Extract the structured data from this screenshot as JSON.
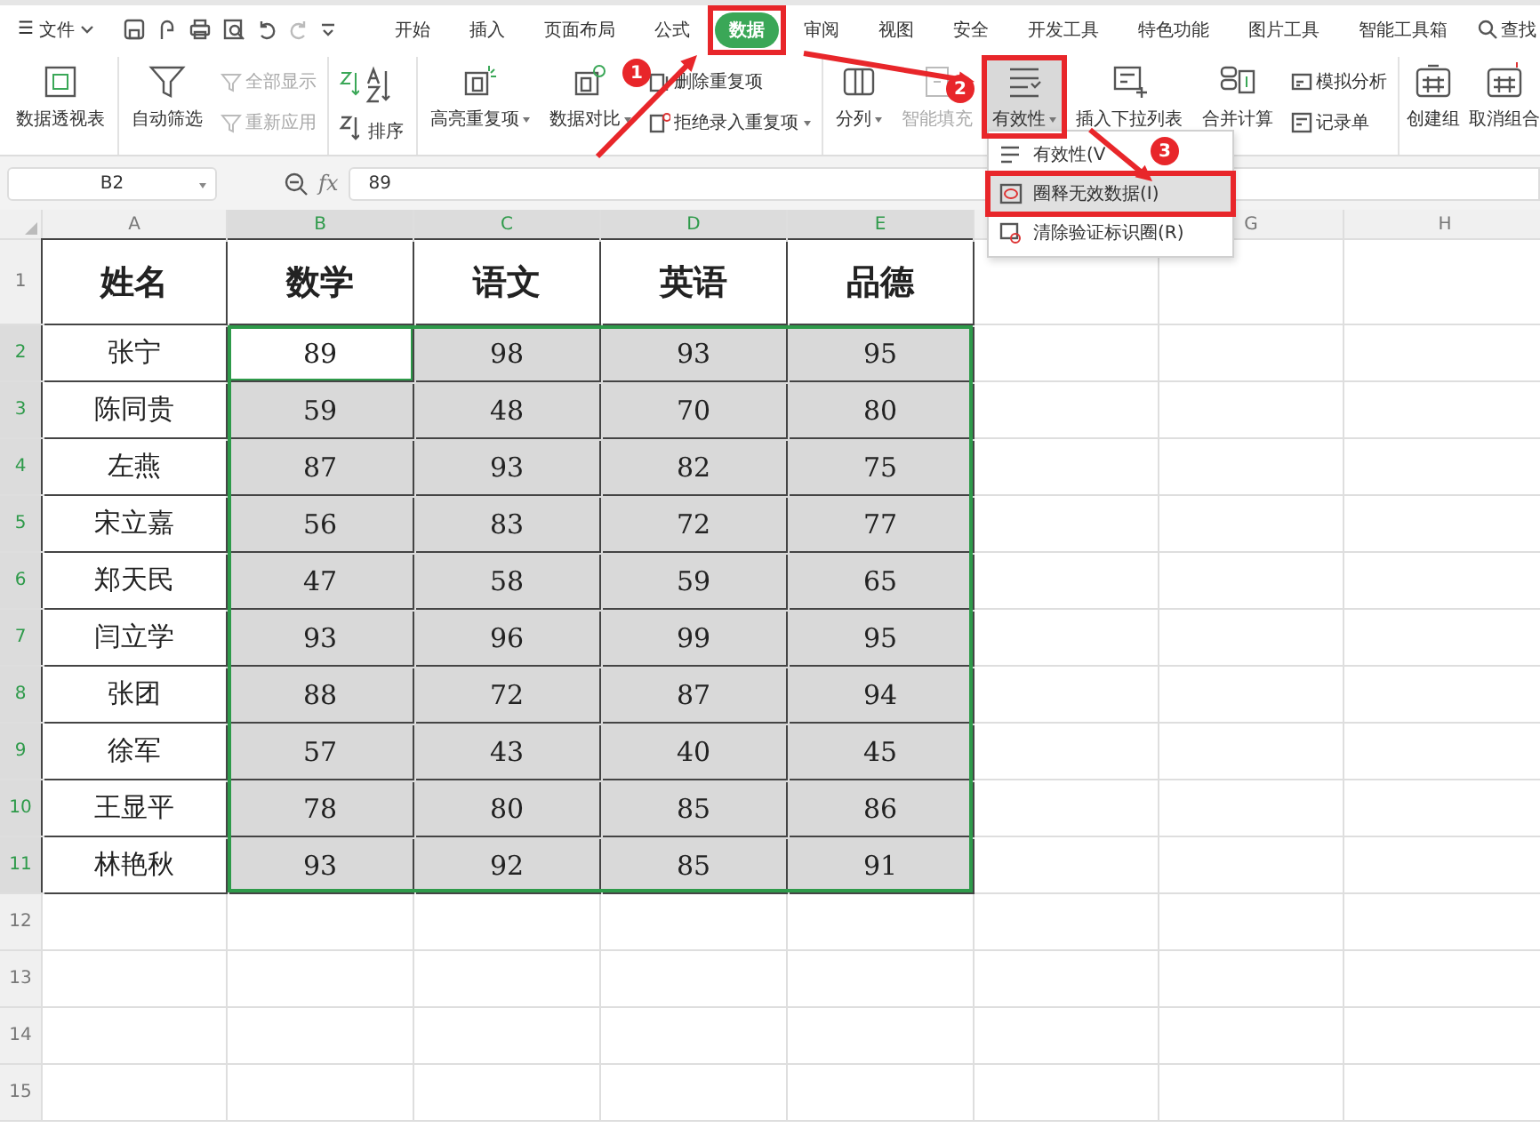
{
  "menubar": {
    "menu_icon": "☰",
    "file_label": "文件",
    "tabs": [
      {
        "label": "开始",
        "selected": false
      },
      {
        "label": "插入",
        "selected": false
      },
      {
        "label": "页面布局",
        "selected": false
      },
      {
        "label": "公式",
        "selected": false
      },
      {
        "label": "数据",
        "selected": true
      },
      {
        "label": "审阅",
        "selected": false
      },
      {
        "label": "视图",
        "selected": false
      },
      {
        "label": "安全",
        "selected": false
      },
      {
        "label": "开发工具",
        "selected": false
      },
      {
        "label": "特色功能",
        "selected": false
      },
      {
        "label": "图片工具",
        "selected": false
      },
      {
        "label": "智能工具箱",
        "selected": false
      }
    ],
    "search_label": "查找"
  },
  "ribbon": {
    "groups": [
      {
        "items": [
          {
            "kind": "large",
            "label": "数据透视表",
            "dropdown": false,
            "disabled": false,
            "pressed": false
          }
        ]
      },
      {
        "items": [
          {
            "kind": "large",
            "label": "自动筛选",
            "dropdown": false,
            "disabled": false,
            "pressed": false
          },
          {
            "kind": "stack",
            "items": [
              {
                "label": "全部显示",
                "dropdown": false,
                "disabled": true
              },
              {
                "label": "重新应用",
                "dropdown": false,
                "disabled": true
              }
            ]
          }
        ]
      },
      {
        "items": [
          {
            "kind": "sort",
            "label": "排序"
          }
        ]
      },
      {
        "items": [
          {
            "kind": "large",
            "label": "高亮重复项",
            "dropdown": true,
            "disabled": false,
            "pressed": false
          },
          {
            "kind": "large",
            "label": "数据对比",
            "dropdown": true,
            "disabled": false,
            "pressed": false
          },
          {
            "kind": "stack",
            "items": [
              {
                "label": "删除重复项",
                "dropdown": false,
                "disabled": false
              },
              {
                "label": "拒绝录入重复项",
                "dropdown": true,
                "disabled": false
              }
            ]
          }
        ]
      },
      {
        "items": [
          {
            "kind": "large",
            "label": "分列",
            "dropdown": true,
            "disabled": false,
            "pressed": false
          },
          {
            "kind": "large",
            "label": "智能填充",
            "dropdown": false,
            "disabled": true,
            "pressed": false
          },
          {
            "kind": "large",
            "label": "有效性",
            "dropdown": true,
            "disabled": false,
            "pressed": true
          },
          {
            "kind": "large",
            "label": "插入下拉列表",
            "dropdown": false,
            "disabled": false,
            "pressed": false
          },
          {
            "kind": "large",
            "label": "合并计算",
            "dropdown": false,
            "disabled": false,
            "pressed": false
          },
          {
            "kind": "stack",
            "items": [
              {
                "label": "模拟分析",
                "dropdown": false,
                "disabled": false
              },
              {
                "label": "记录单",
                "dropdown": false,
                "disabled": false
              }
            ]
          }
        ]
      },
      {
        "items": [
          {
            "kind": "large",
            "label": "创建组",
            "dropdown": false,
            "disabled": false,
            "pressed": false
          },
          {
            "kind": "large",
            "label": "取消组合",
            "dropdown": false,
            "disabled": false,
            "pressed": false
          }
        ]
      }
    ]
  },
  "formula_bar": {
    "cell_ref": "B2",
    "fx": "fx",
    "value": "89"
  },
  "sheet": {
    "columns": [
      "A",
      "B",
      "C",
      "D",
      "E",
      null,
      "G",
      "H"
    ],
    "header_row": {
      "number": "1",
      "cells": [
        "姓名",
        "数学",
        "语文",
        "英语",
        "品德"
      ]
    },
    "rows": [
      {
        "number": "2",
        "cells": [
          {
            "text": "张宁",
            "selected": false,
            "active": false
          },
          {
            "text": "89",
            "selected": true,
            "active": true
          },
          {
            "text": "98",
            "selected": true,
            "active": false
          },
          {
            "text": "93",
            "selected": true,
            "active": false
          },
          {
            "text": "95",
            "selected": true,
            "active": false
          }
        ]
      },
      {
        "number": "3",
        "cells": [
          {
            "text": "陈同贵",
            "selected": false,
            "active": false
          },
          {
            "text": "59",
            "selected": true,
            "active": false
          },
          {
            "text": "48",
            "selected": true,
            "active": false
          },
          {
            "text": "70",
            "selected": true,
            "active": false
          },
          {
            "text": "80",
            "selected": true,
            "active": false
          }
        ]
      },
      {
        "number": "4",
        "cells": [
          {
            "text": "左燕",
            "selected": false,
            "active": false
          },
          {
            "text": "87",
            "selected": true,
            "active": false
          },
          {
            "text": "93",
            "selected": true,
            "active": false
          },
          {
            "text": "82",
            "selected": true,
            "active": false
          },
          {
            "text": "75",
            "selected": true,
            "active": false
          }
        ]
      },
      {
        "number": "5",
        "cells": [
          {
            "text": "宋立嘉",
            "selected": false,
            "active": false
          },
          {
            "text": "56",
            "selected": true,
            "active": false
          },
          {
            "text": "83",
            "selected": true,
            "active": false
          },
          {
            "text": "72",
            "selected": true,
            "active": false
          },
          {
            "text": "77",
            "selected": true,
            "active": false
          }
        ]
      },
      {
        "number": "6",
        "cells": [
          {
            "text": "郑天民",
            "selected": false,
            "active": false
          },
          {
            "text": "47",
            "selected": true,
            "active": false
          },
          {
            "text": "58",
            "selected": true,
            "active": false
          },
          {
            "text": "59",
            "selected": true,
            "active": false
          },
          {
            "text": "65",
            "selected": true,
            "active": false
          }
        ]
      },
      {
        "number": "7",
        "cells": [
          {
            "text": "闫立学",
            "selected": false,
            "active": false
          },
          {
            "text": "93",
            "selected": true,
            "active": false
          },
          {
            "text": "96",
            "selected": true,
            "active": false
          },
          {
            "text": "99",
            "selected": true,
            "active": false
          },
          {
            "text": "95",
            "selected": true,
            "active": false
          }
        ]
      },
      {
        "number": "8",
        "cells": [
          {
            "text": "张团",
            "selected": false,
            "active": false
          },
          {
            "text": "88",
            "selected": true,
            "active": false
          },
          {
            "text": "72",
            "selected": true,
            "active": false
          },
          {
            "text": "87",
            "selected": true,
            "active": false
          },
          {
            "text": "94",
            "selected": true,
            "active": false
          }
        ]
      },
      {
        "number": "9",
        "cells": [
          {
            "text": "徐军",
            "selected": false,
            "active": false
          },
          {
            "text": "57",
            "selected": true,
            "active": false
          },
          {
            "text": "43",
            "selected": true,
            "active": false
          },
          {
            "text": "40",
            "selected": true,
            "active": false
          },
          {
            "text": "45",
            "selected": true,
            "active": false
          }
        ]
      },
      {
        "number": "10",
        "cells": [
          {
            "text": "王显平",
            "selected": false,
            "active": false
          },
          {
            "text": "78",
            "selected": true,
            "active": false
          },
          {
            "text": "80",
            "selected": true,
            "active": false
          },
          {
            "text": "85",
            "selected": true,
            "active": false
          },
          {
            "text": "86",
            "selected": true,
            "active": false
          }
        ]
      },
      {
        "number": "11",
        "cells": [
          {
            "text": "林艳秋",
            "selected": false,
            "active": false
          },
          {
            "text": "93",
            "selected": true,
            "active": false
          },
          {
            "text": "92",
            "selected": true,
            "active": false
          },
          {
            "text": "85",
            "selected": true,
            "active": false
          },
          {
            "text": "91",
            "selected": true,
            "active": false
          }
        ]
      },
      {
        "number": "12",
        "cells": []
      },
      {
        "number": "13",
        "cells": []
      },
      {
        "number": "14",
        "cells": []
      },
      {
        "number": "15",
        "cells": []
      }
    ]
  },
  "dropdown": {
    "items": [
      {
        "label": "有效性(V",
        "selected": false
      },
      {
        "label": "圈释无效数据(I)",
        "selected": true
      },
      {
        "label": "清除验证标识圈(R)",
        "selected": false
      }
    ]
  },
  "callouts": {
    "badges": [
      "1",
      "2",
      "3"
    ]
  }
}
